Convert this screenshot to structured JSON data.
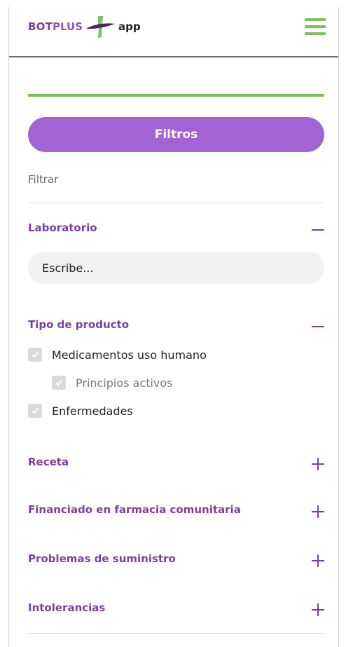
{
  "header": {
    "logo_bot": "BOT",
    "logo_plus": "PLUS",
    "logo_app": "app",
    "colors": {
      "purple": "#7c3fa0",
      "green": "#7cc35d"
    }
  },
  "filters": {
    "button_label": "Filtros",
    "filter_label": "Filtrar",
    "button_color": "#a463d2",
    "laboratorio": {
      "title": "Laboratorio",
      "expanded": true,
      "input_placeholder": "Escribe..."
    },
    "tipo_producto": {
      "title": "Tipo de producto",
      "expanded": true,
      "options": [
        {
          "label": "Medicamentos uso humano",
          "checked": true
        },
        {
          "label": "Principios activos",
          "checked": true
        },
        {
          "label": "Enfermedades",
          "checked": true
        }
      ]
    },
    "collapsed_sections": [
      {
        "title": "Receta"
      },
      {
        "title": "Financiado en farmacia comunitaria"
      },
      {
        "title": "Problemas de suministro"
      },
      {
        "title": "Intolerancias"
      }
    ]
  }
}
